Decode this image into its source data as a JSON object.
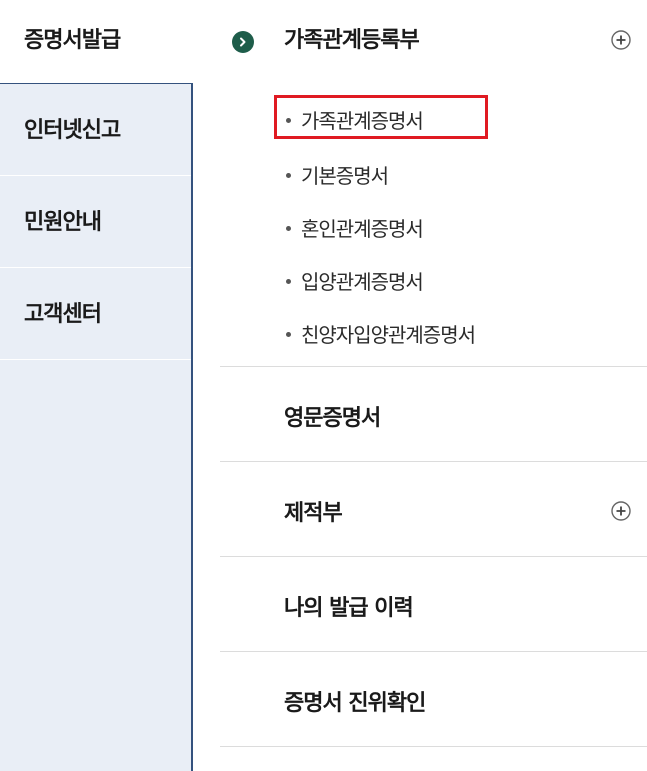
{
  "left_nav": {
    "active": "증명서발급",
    "items": [
      {
        "label": "인터넷신고"
      },
      {
        "label": "민원안내"
      },
      {
        "label": "고객센터"
      }
    ]
  },
  "right_menu": {
    "section": {
      "title": "가족관계등록부",
      "expand_icon": "plus-circle-icon",
      "bullet_icon": "arrow-right-circle-icon",
      "sub_items": [
        {
          "label": "가족관계증명서",
          "highlighted": true
        },
        {
          "label": "기본증명서"
        },
        {
          "label": "혼인관계증명서"
        },
        {
          "label": "입양관계증명서"
        },
        {
          "label": "친양자입양관계증명서"
        }
      ]
    },
    "rows": [
      {
        "label": "영문증명서"
      },
      {
        "label": "제적부",
        "expand_icon": "plus-circle-icon"
      },
      {
        "label": "나의 발급 이력"
      },
      {
        "label": "증명서 진위확인"
      }
    ]
  },
  "colors": {
    "left_panel_bg": "#e9eef6",
    "left_panel_border": "#34527e",
    "section_bullet": "#1e5d4a",
    "highlight_border": "#e01a22",
    "divider": "#dcdcdc"
  }
}
